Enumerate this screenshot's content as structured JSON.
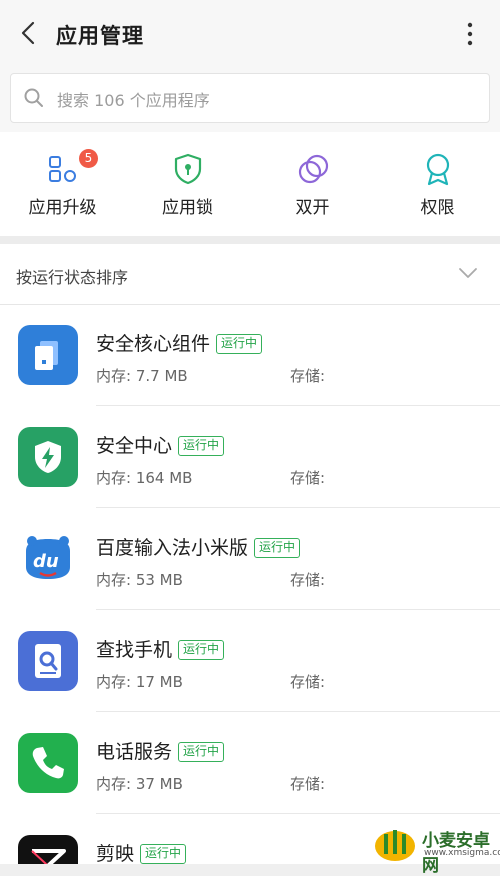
{
  "header": {
    "title": "应用管理",
    "back_icon": "back-arrow-icon",
    "more_icon": "more-vertical-icon"
  },
  "search": {
    "placeholder": "搜索 106 个应用程序",
    "icon": "search-icon"
  },
  "quick_actions": [
    {
      "label": "应用升级",
      "icon": "apps-grid-icon",
      "badge": "5"
    },
    {
      "label": "应用锁",
      "icon": "shield-lock-icon"
    },
    {
      "label": "双开",
      "icon": "dual-circle-icon"
    },
    {
      "label": "权限",
      "icon": "ribbon-icon"
    }
  ],
  "sort": {
    "label": "按运行状态排序",
    "icon": "chevron-down-icon"
  },
  "apps": [
    {
      "name": "安全核心组件",
      "status": "运行中",
      "memory": "内存: 7.7 MB",
      "storage": "存储:",
      "icon_color": "#2f7fd9"
    },
    {
      "name": "安全中心",
      "status": "运行中",
      "memory": "内存: 164 MB",
      "storage": "存储:",
      "icon_color": "#27a165"
    },
    {
      "name": "百度输入法小米版",
      "status": "运行中",
      "memory": "内存: 53 MB",
      "storage": "存储:",
      "icon_color": "#2f7fd9"
    },
    {
      "name": "查找手机",
      "status": "运行中",
      "memory": "内存: 17 MB",
      "storage": "存储:",
      "icon_color": "#4b6fd6"
    },
    {
      "name": "电话服务",
      "status": "运行中",
      "memory": "内存: 37 MB",
      "storage": "存储:",
      "icon_color": "#22b04e"
    },
    {
      "name": "剪映",
      "status": "运行中",
      "memory": "",
      "storage": "",
      "icon_color": "#111111"
    }
  ],
  "watermark": {
    "title": "小麦安卓网",
    "url": "www.xmsigma.com"
  }
}
